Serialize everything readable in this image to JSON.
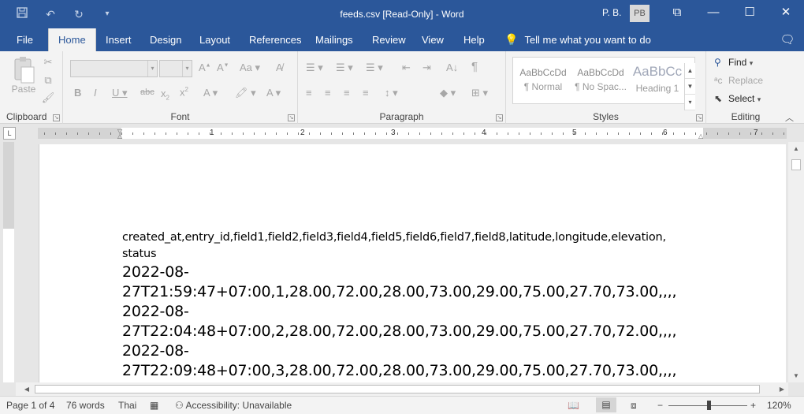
{
  "window": {
    "title": "feeds.csv [Read-Only] - Word",
    "user_name": "P. B.",
    "user_initials": "PB"
  },
  "qat": [
    "save-icon",
    "undo-icon",
    "redo-icon",
    "customize-qat-icon"
  ],
  "tabs": [
    {
      "label": "File"
    },
    {
      "label": "Home"
    },
    {
      "label": "Insert"
    },
    {
      "label": "Design"
    },
    {
      "label": "Layout"
    },
    {
      "label": "References"
    },
    {
      "label": "Mailings"
    },
    {
      "label": "Review"
    },
    {
      "label": "View"
    },
    {
      "label": "Help"
    }
  ],
  "tell_me": "Tell me what you want to do",
  "ribbon": {
    "clipboard": {
      "label": "Clipboard",
      "paste": "Paste"
    },
    "font": {
      "label": "Font",
      "font_name": "",
      "font_size": ""
    },
    "paragraph": {
      "label": "Paragraph"
    },
    "styles": {
      "label": "Styles",
      "items": [
        {
          "sample": "AaBbCcDd",
          "name": "¶ Normal"
        },
        {
          "sample": "AaBbCcDd",
          "name": "¶ No Spac..."
        },
        {
          "sample": "AaBbCc",
          "name": "Heading 1"
        }
      ]
    },
    "editing": {
      "label": "Editing",
      "find": "Find",
      "replace": "Replace",
      "select": "Select"
    }
  },
  "ruler": {
    "numbers": [
      "1",
      "2",
      "3",
      "4",
      "5",
      "6",
      "7"
    ]
  },
  "document": {
    "header_line": "created_at,entry_id,field1,field2,field3,field4,field5,field6,field7,field8,latitude,longitude,elevation,",
    "header_line2": "status",
    "rows": [
      {
        "date": "2022-08-",
        "rest": "27T21:59:47+07:00,1,28.00,72.00,28.00,73.00,29.00,75.00,27.70,73.00,,,,"
      },
      {
        "date": "2022-08-",
        "rest": "27T22:04:48+07:00,2,28.00,72.00,28.00,73.00,29.00,75.00,27.70,72.00,,,,"
      },
      {
        "date": "2022-08-",
        "rest": "27T22:09:48+07:00,3,28.00,72.00,28.00,73.00,29.00,75.00,27.70,73.00,,,,"
      }
    ]
  },
  "status": {
    "page": "Page 1 of 4",
    "words": "76 words",
    "language": "Thai",
    "accessibility": "Accessibility: Unavailable",
    "zoom": "120%"
  }
}
